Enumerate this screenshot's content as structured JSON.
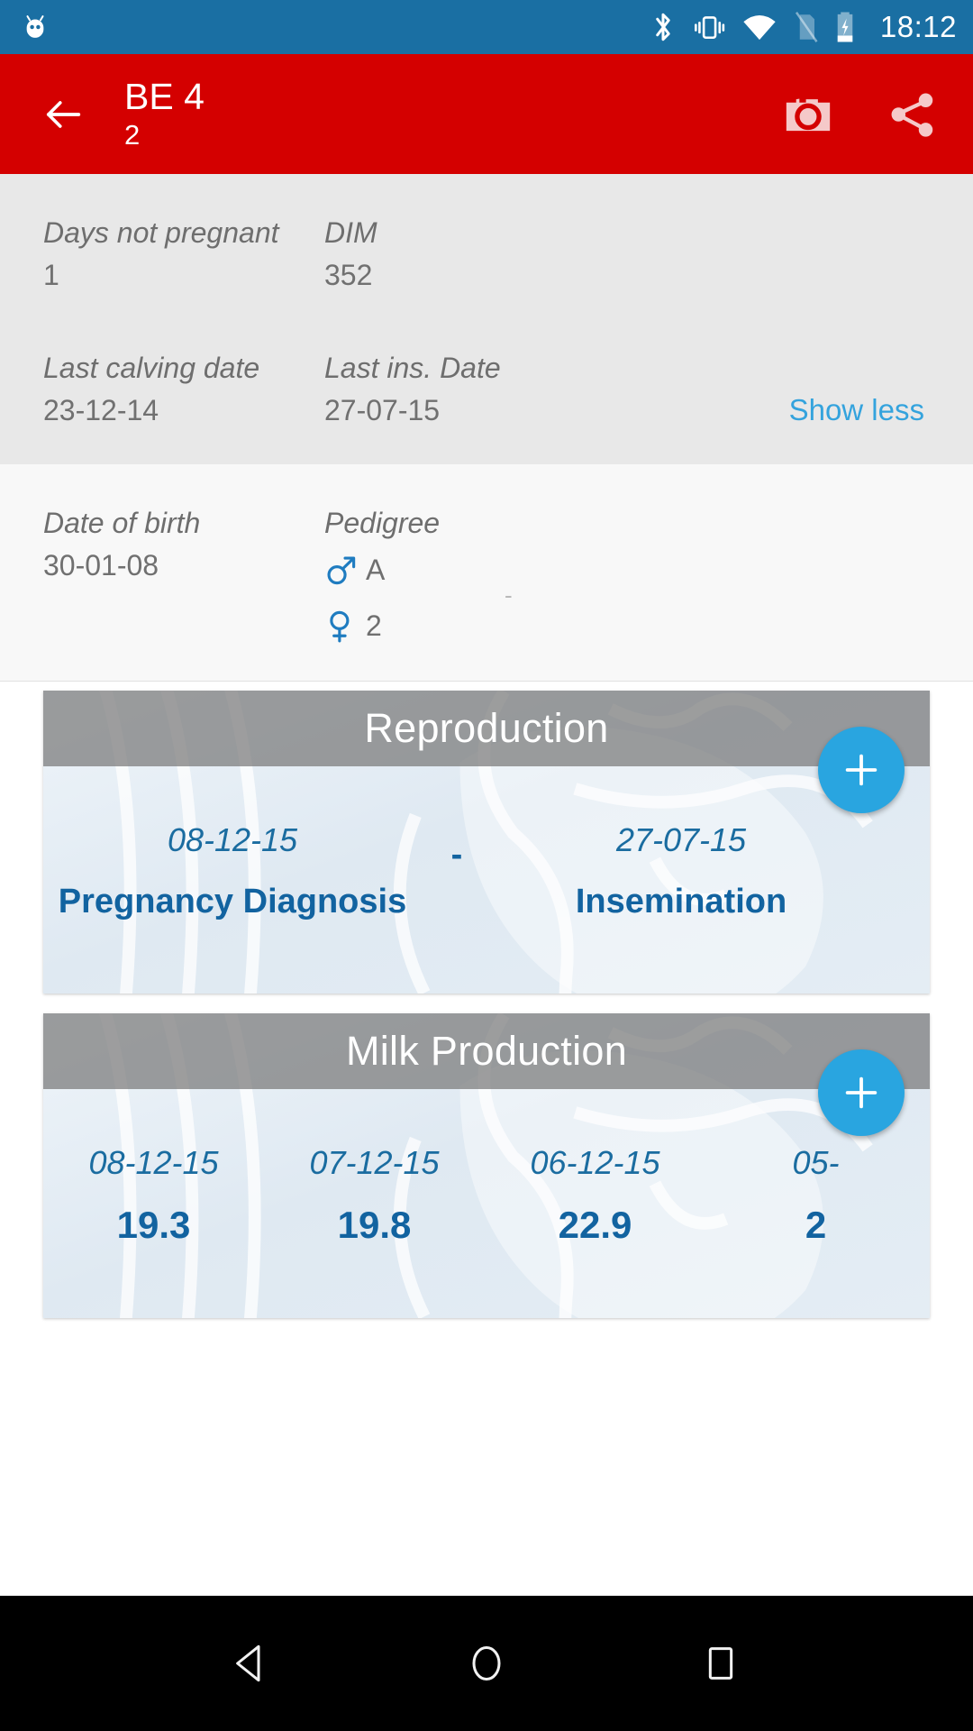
{
  "status_bar": {
    "time": "18:12",
    "icons": [
      "android-head-icon",
      "bluetooth-icon",
      "vibrate-icon",
      "wifi-icon",
      "no-sim-icon",
      "battery-charging-icon"
    ],
    "background_color": "#1a6fa3"
  },
  "app_bar": {
    "background_color": "#d40000",
    "back_icon": "back-arrow-icon",
    "title": "BE 4",
    "subtitle": "2",
    "camera_icon": "camera-icon",
    "share_icon": "share-icon"
  },
  "info_panel": {
    "rows": [
      {
        "left_label": "Days not pregnant",
        "left_value": "1",
        "right_label": "DIM",
        "right_value": "352"
      },
      {
        "left_label": "Last calving date",
        "left_value": "23-12-14",
        "right_label": "Last ins. Date",
        "right_value": "27-07-15"
      }
    ],
    "toggle_label": "Show less",
    "toggle_color": "#34a3dd",
    "birth": {
      "label": "Date of birth",
      "value": "30-01-08"
    },
    "pedigree": {
      "label": "Pedigree",
      "sire_symbol": "male-symbol-icon",
      "sire_value": "A",
      "dam_symbol": "female-symbol-icon",
      "dam_value": "2",
      "separator": "-"
    }
  },
  "cards": [
    {
      "id": "reproduction",
      "title": "Reproduction",
      "add_button": "add-reproduction-button",
      "entries": [
        {
          "date": "08-12-15",
          "name": "Pregnancy Diagnosis"
        },
        {
          "date": "",
          "name": "-"
        },
        {
          "date": "27-07-15",
          "name": "Insemination"
        }
      ]
    },
    {
      "id": "milk-production",
      "title": "Milk Production",
      "add_button": "add-milk-production-button",
      "entries": [
        {
          "date": "08-12-15",
          "value": "19.3"
        },
        {
          "date": "07-12-15",
          "value": "19.8"
        },
        {
          "date": "06-12-15",
          "value": "22.9"
        },
        {
          "date": "05-",
          "value": "2"
        }
      ]
    }
  ],
  "nav_bar": {
    "back": "nav-back-icon",
    "home": "nav-home-icon",
    "recents": "nav-recents-icon"
  },
  "colors": {
    "accent_blue": "#29a5e0",
    "data_blue": "#1263a0",
    "app_red": "#d40000",
    "status_blue": "#1a6fa3"
  }
}
